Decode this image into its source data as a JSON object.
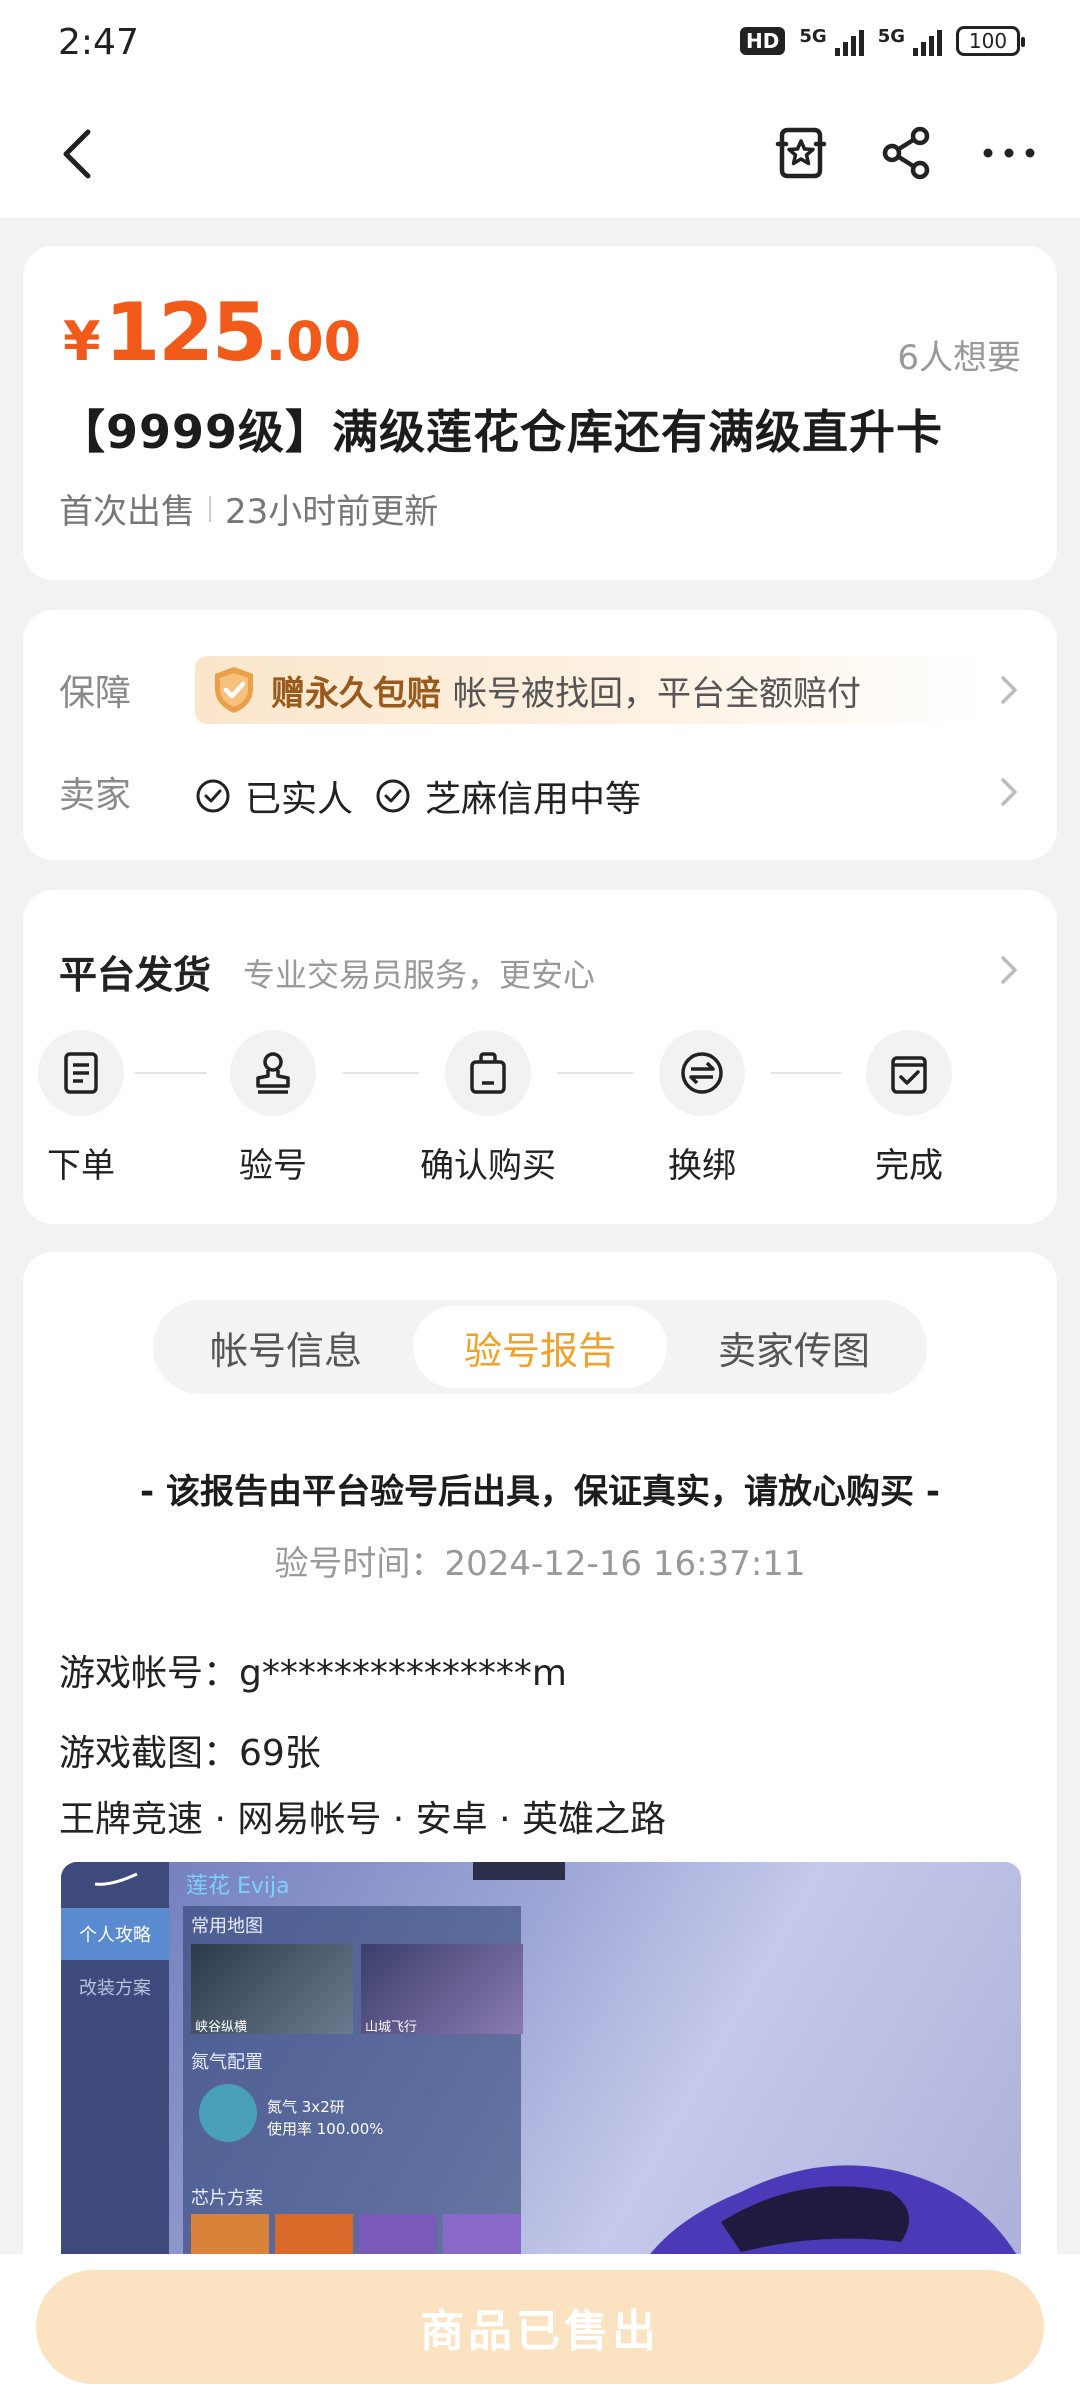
{
  "status_bar": {
    "time": "2:47",
    "hd_badge": "HD",
    "net1": "5G",
    "net2": "5G",
    "battery": "100"
  },
  "nav": {
    "icons": [
      "back-icon",
      "favorite-star-icon",
      "share-icon",
      "more-icon"
    ]
  },
  "product": {
    "price_symbol": "¥",
    "price_int": "125",
    "price_dec": ".00",
    "wants": "6人想要",
    "title": "【9999级】满级莲花仓库还有满级直升卡",
    "first_sale": "首次出售",
    "updated": "23小时前更新",
    "price_color": "#f25a1a"
  },
  "assurance": {
    "guarantee_label": "保障",
    "guarantee_strong": "赠永久包赔",
    "guarantee_text": "帐号被找回，平台全额赔付",
    "seller_label": "卖家",
    "seller_badges": [
      "已实人",
      "芝麻信用中等"
    ]
  },
  "shipping": {
    "title": "平台发货",
    "subtitle": "专业交易员服务，更安心",
    "steps": [
      {
        "label": "下单",
        "icon": "order-doc-icon"
      },
      {
        "label": "验号",
        "icon": "verify-stamp-icon"
      },
      {
        "label": "确认购买",
        "icon": "shopping-bag-icon"
      },
      {
        "label": "换绑",
        "icon": "exchange-icon"
      },
      {
        "label": "完成",
        "icon": "complete-check-icon"
      }
    ]
  },
  "report": {
    "tabs": [
      "帐号信息",
      "验号报告",
      "卖家传图"
    ],
    "active_tab": "验号报告",
    "headline": "- 该报告由平台验号后出具，保证真实，请放心购买 -",
    "time": "验号时间：2024-12-16 16:37:11",
    "account": "游戏帐号：g***************m",
    "screenshots": "游戏截图：69张",
    "tags": "王牌竞速 · 网易帐号 · 安卓 · 英雄之路",
    "accent_color": "#f0a12a",
    "screenshot": {
      "title": "莲花 Evija",
      "side_active": "个人攻略",
      "side_item": "改装方案",
      "sec_maps": "常用地图",
      "map1": "峡谷纵横",
      "map2": "山城飞行",
      "sec_nitro": "氮气配置",
      "nitro_line1": "氮气 3x2研",
      "nitro_line2": "使用率 100.00%",
      "sec_chips": "芯片方案"
    }
  },
  "bottom": {
    "sold_button": "商品已售出"
  }
}
